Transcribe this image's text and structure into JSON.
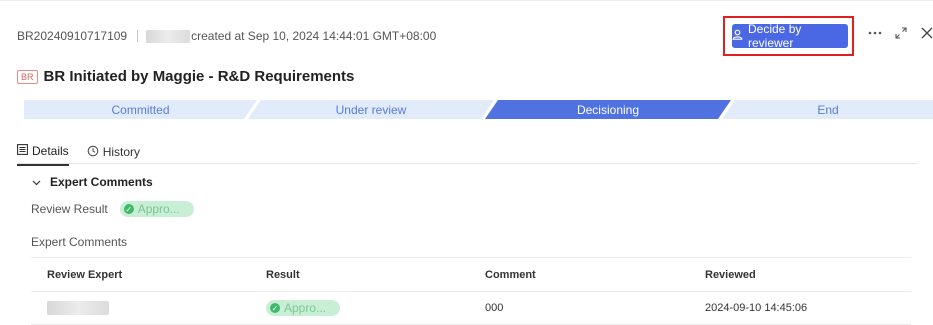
{
  "header": {
    "request_id": "BR20240910717109",
    "created_text": "created at Sep 10, 2024 14:44:01 GMT+08:00",
    "decide_button": "Decide by reviewer"
  },
  "title": {
    "tag": "BR",
    "text": "BR Initiated by Maggie - R&D Requirements"
  },
  "steps": [
    {
      "label": "Committed"
    },
    {
      "label": "Under review"
    },
    {
      "label": "Decisioning"
    },
    {
      "label": "End"
    }
  ],
  "tabs": [
    {
      "label": "Details"
    },
    {
      "label": "History"
    }
  ],
  "section": {
    "title": "Expert Comments",
    "review_result_label": "Review Result",
    "review_result_value": "Appro...",
    "expert_comments_label": "Expert Comments"
  },
  "table": {
    "headers": [
      "Review Expert",
      "Result",
      "Comment",
      "Reviewed"
    ],
    "rows": [
      {
        "result": "Appro...",
        "comment": "000",
        "reviewed": "2024-09-10 14:45:06"
      }
    ]
  },
  "colors": {
    "accent": "#4a68e3",
    "step_active": "#4f72e0",
    "step_inactive": "#e2ebfa",
    "highlight_box": "#e02020",
    "approved_bg": "#c8efd5",
    "approved_dot": "#3dba6a"
  },
  "icons": [
    "user-icon",
    "more-icon",
    "expand-icon",
    "close-icon",
    "details-icon",
    "history-icon",
    "chevron-down-icon",
    "check-icon"
  ]
}
